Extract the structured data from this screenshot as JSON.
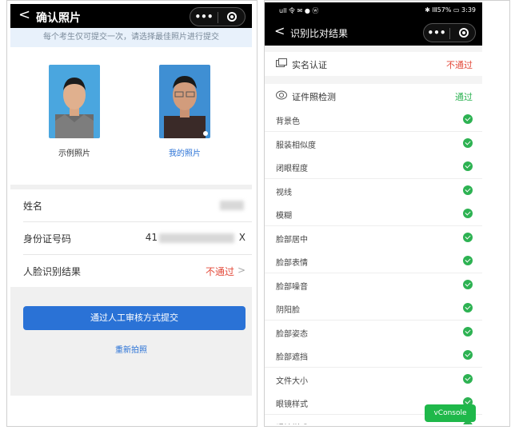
{
  "left": {
    "nav": {
      "back": "<",
      "title": "确认照片",
      "menu": "•••"
    },
    "notice": "每个考生仅可提交一次，请选择最佳照片进行提交",
    "photos": {
      "sample_caption": "示例照片",
      "mine_caption": "我的照片"
    },
    "info": {
      "name_label": "姓名",
      "id_label": "身份证号码",
      "id_prefix": "41",
      "id_suffix": "X",
      "face_label": "人脸识别结果",
      "face_value": "不通过",
      "chevron": ">"
    },
    "submit_label": "通过人工审核方式提交",
    "retake_label": "重新拍照"
  },
  "right": {
    "status": {
      "left": "ull 令 ✉ ● ⓦ",
      "right": "✱ ⅠⅡ57% ▭ 3:39"
    },
    "nav": {
      "back": "<",
      "title": "识别比对结果",
      "menu": "•••"
    },
    "realname": {
      "title": "实名认证",
      "result": "不通过"
    },
    "photo_check": {
      "title": "证件照检测",
      "result": "通过"
    },
    "checks": [
      "背景色",
      "服装相似度",
      "闭眼程度",
      "视线",
      "模糊",
      "脸部居中",
      "脸部表情",
      "脸部噪音",
      "阴阳脸",
      "脸部姿态",
      "脸部遮挡",
      "文件大小",
      "眼镜样式",
      "眼镜样式"
    ],
    "vconsole": "vConsole"
  },
  "colors": {
    "fail": "#e34a3a",
    "pass": "#2db252",
    "primary": "#2a72d6"
  }
}
